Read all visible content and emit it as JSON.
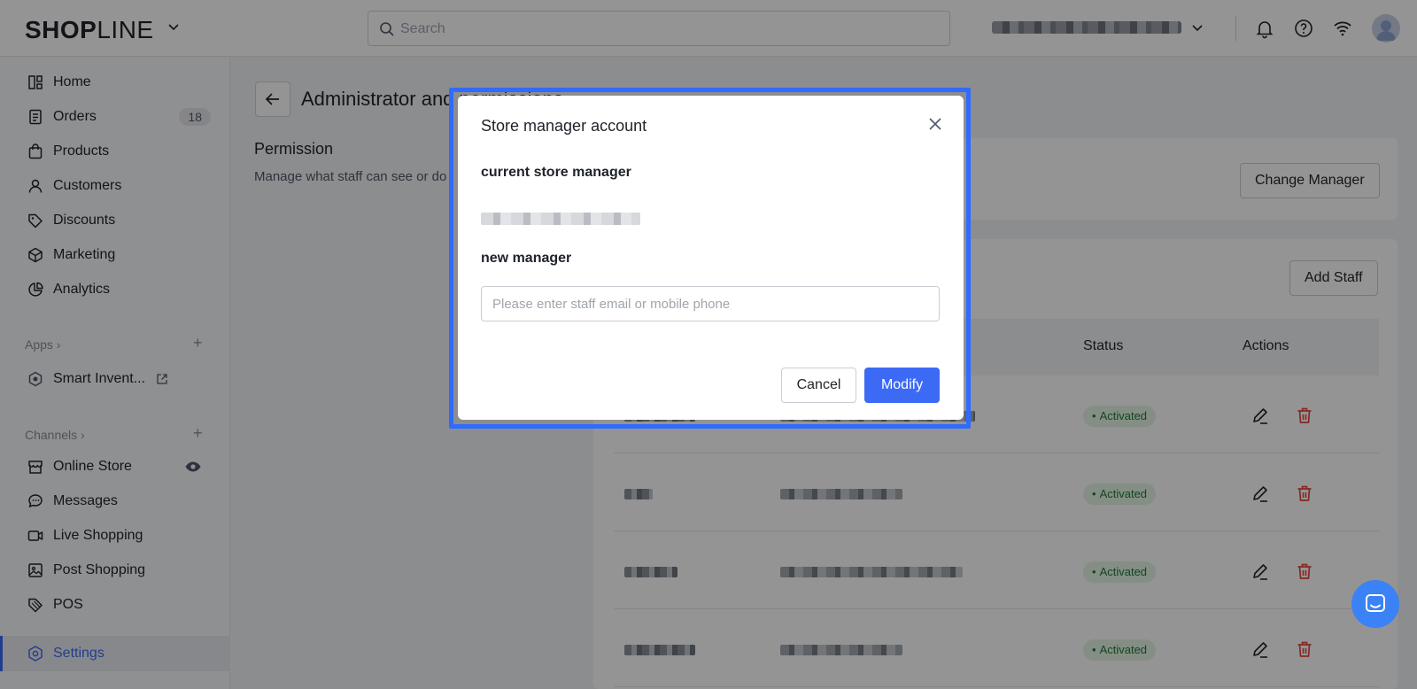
{
  "header": {
    "logo_bold": "SHOP",
    "logo_thin": "LINE",
    "search_placeholder": "Search"
  },
  "sidebar": {
    "items": [
      {
        "label": "Home",
        "icon": "home-icon"
      },
      {
        "label": "Orders",
        "icon": "orders-icon",
        "badge": "18"
      },
      {
        "label": "Products",
        "icon": "products-icon"
      },
      {
        "label": "Customers",
        "icon": "customers-icon"
      },
      {
        "label": "Discounts",
        "icon": "discounts-icon"
      },
      {
        "label": "Marketing",
        "icon": "marketing-icon"
      },
      {
        "label": "Analytics",
        "icon": "analytics-icon"
      }
    ],
    "apps_title": "Apps",
    "apps": [
      {
        "label": "Smart Invent...",
        "icon": "app-icon"
      }
    ],
    "channels_title": "Channels",
    "channels": [
      {
        "label": "Online Store",
        "icon": "store-icon"
      },
      {
        "label": "Messages",
        "icon": "messages-icon"
      },
      {
        "label": "Live Shopping",
        "icon": "live-icon"
      },
      {
        "label": "Post Shopping",
        "icon": "post-icon"
      },
      {
        "label": "POS",
        "icon": "pos-icon"
      }
    ],
    "settings_label": "Settings",
    "active_color": "#3d6af5"
  },
  "main": {
    "page_title": "Administrator and permissions",
    "permission_title": "Permission",
    "permission_desc": "Manage what staff can see or do",
    "change_manager_label": "Change Manager",
    "add_staff_label": "Add Staff",
    "table": {
      "columns": [
        "Status",
        "Actions"
      ],
      "rows": [
        {
          "status": "Activated"
        },
        {
          "status": "Activated"
        },
        {
          "status": "Activated"
        },
        {
          "status": "Activated"
        }
      ]
    }
  },
  "modal": {
    "title": "Store manager account",
    "current_label": "current store manager",
    "new_label": "new manager",
    "input_placeholder": "Please enter staff email or mobile phone",
    "cancel_label": "Cancel",
    "modify_label": "Modify",
    "highlight_color": "#2f6bff",
    "primary_color": "#3d6af5"
  }
}
